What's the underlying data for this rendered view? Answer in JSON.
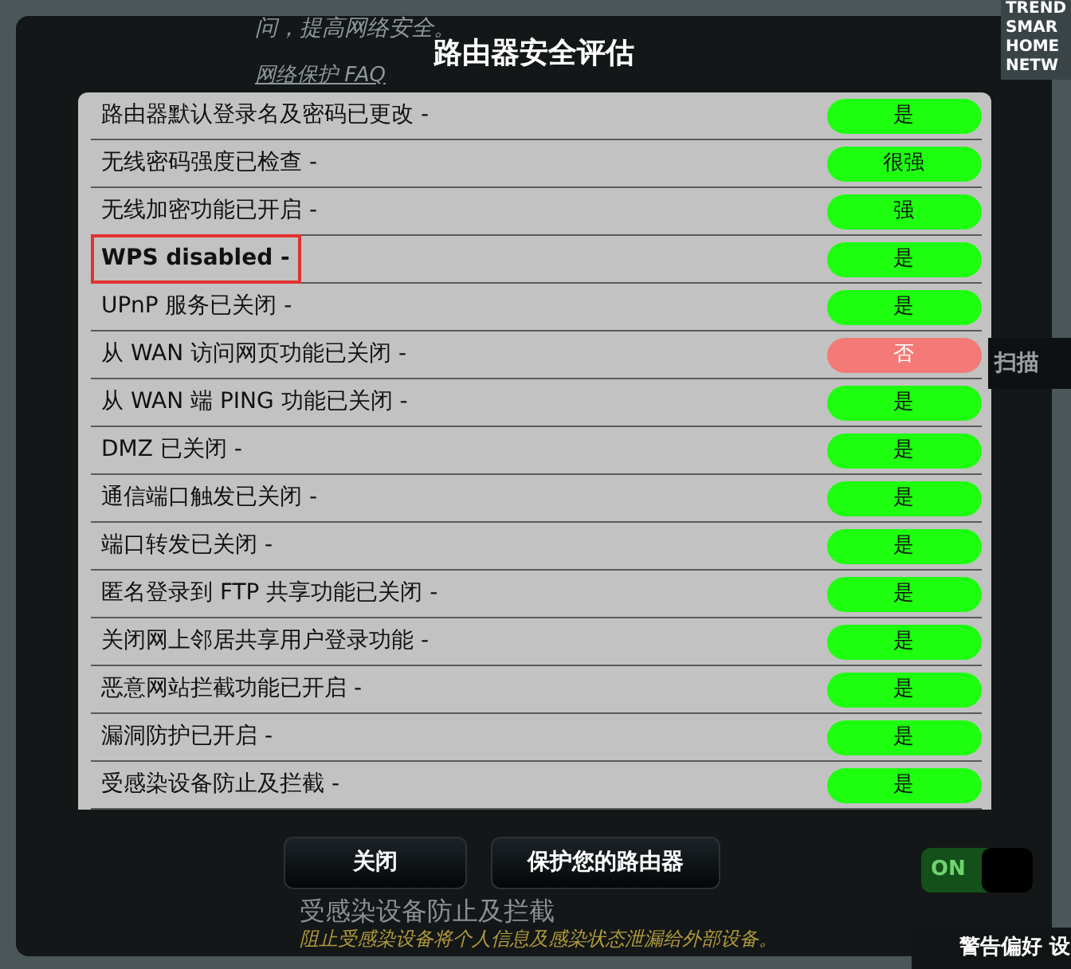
{
  "background": {
    "intro_tail": "问，提高网络安全。",
    "faq_link": "网络保护 FAQ",
    "scan_button": "扫描",
    "feature_title": "受感染设备防止及拦截",
    "feature_desc": "阻止受感染设备将个人信息及感染状态泄漏给外部设备。",
    "toggle": {
      "label": "ON",
      "on": true
    },
    "alert_button": "警告偏好 设",
    "logo_lines": [
      "TREND",
      "SMAR",
      "HOME",
      "NETW"
    ]
  },
  "dialog": {
    "title": "路由器安全评估",
    "rows": [
      {
        "label": "路由器默认登录名及密码已更改 -",
        "status": "是",
        "ok": true,
        "highlighted": false
      },
      {
        "label": "无线密码强度已检查 -",
        "status": "很强",
        "ok": true,
        "highlighted": false
      },
      {
        "label": "无线加密功能已开启 -",
        "status": "强",
        "ok": true,
        "highlighted": false
      },
      {
        "label": "WPS disabled -",
        "status": "是",
        "ok": true,
        "highlighted": true
      },
      {
        "label": "UPnP 服务已关闭 -",
        "status": "是",
        "ok": true,
        "highlighted": false
      },
      {
        "label": "从 WAN 访问网页功能已关闭 -",
        "status": "否",
        "ok": false,
        "highlighted": false
      },
      {
        "label": "从 WAN 端 PING 功能已关闭 -",
        "status": "是",
        "ok": true,
        "highlighted": false
      },
      {
        "label": "DMZ 已关闭 -",
        "status": "是",
        "ok": true,
        "highlighted": false
      },
      {
        "label": "通信端口触发已关闭 -",
        "status": "是",
        "ok": true,
        "highlighted": false
      },
      {
        "label": "端口转发已关闭 -",
        "status": "是",
        "ok": true,
        "highlighted": false
      },
      {
        "label": "匿名登录到 FTP 共享功能已关闭 -",
        "status": "是",
        "ok": true,
        "highlighted": false
      },
      {
        "label": "关闭网上邻居共享用户登录功能 -",
        "status": "是",
        "ok": true,
        "highlighted": false
      },
      {
        "label": "恶意网站拦截功能已开启 -",
        "status": "是",
        "ok": true,
        "highlighted": false
      },
      {
        "label": "漏洞防护已开启 -",
        "status": "是",
        "ok": true,
        "highlighted": false
      },
      {
        "label": "受感染设备防止及拦截 -",
        "status": "是",
        "ok": true,
        "highlighted": false
      }
    ],
    "buttons": [
      "关闭",
      "保护您的路由器"
    ]
  }
}
